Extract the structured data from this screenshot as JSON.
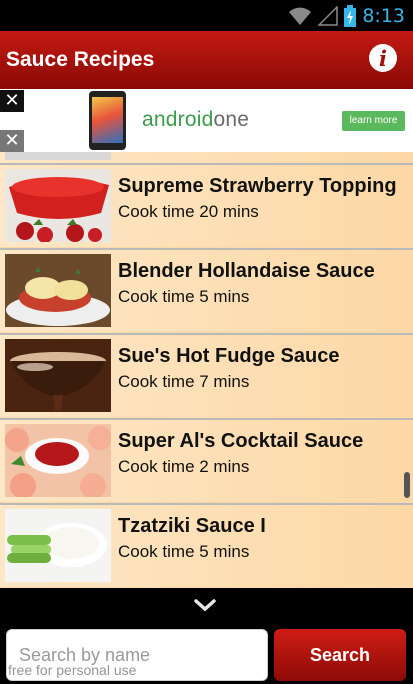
{
  "status_bar": {
    "time": "8:13",
    "icons": [
      "wifi-icon",
      "signal-icon",
      "battery-charging-icon"
    ],
    "accent_color": "#37b6e8"
  },
  "app_bar": {
    "title": "Sauce Recipes",
    "info_icon": "info-icon",
    "info_glyph": "i",
    "colors": {
      "top": "#c41a12",
      "bottom": "#8a0a06"
    }
  },
  "ad": {
    "close_glyph": "✕",
    "brand_prefix": "android",
    "brand_suffix": "one",
    "cta": "learn more",
    "brand_color": "#3c9c4a"
  },
  "recipes": [
    {
      "name": "Supreme Strawberry Topping",
      "cook_time": "Cook time 20 mins"
    },
    {
      "name": "Blender Hollandaise Sauce",
      "cook_time": "Cook time 5 mins"
    },
    {
      "name": "Sue's Hot Fudge Sauce",
      "cook_time": "Cook time 7 mins"
    },
    {
      "name": "Super Al's Cocktail Sauce",
      "cook_time": "Cook time 2 mins"
    },
    {
      "name": "Tzatziki Sauce I",
      "cook_time": "Cook time 5 mins"
    }
  ],
  "more_indicator": "chevron-down-icon",
  "search": {
    "placeholder": "Search by name",
    "button_label": "Search",
    "button_color": "#b8140d"
  },
  "watermark": "free for personal use"
}
